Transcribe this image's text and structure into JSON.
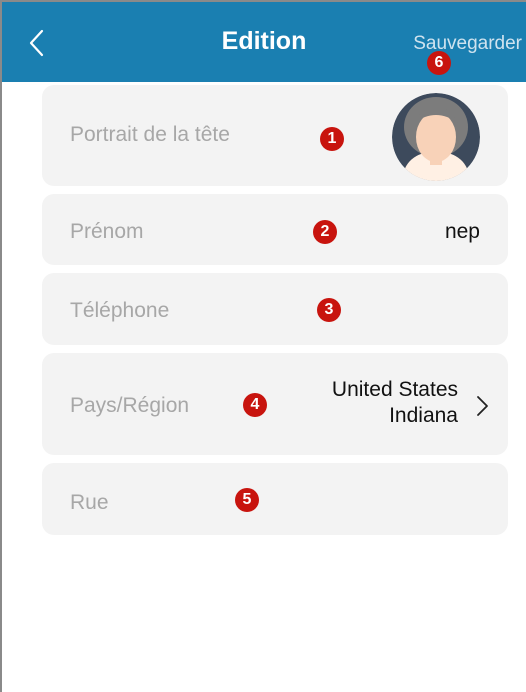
{
  "header": {
    "title": "Edition",
    "save_label": "Sauvegarder",
    "background": "#1a7fb1",
    "back_icon": "chevron-left-icon"
  },
  "form": {
    "portrait": {
      "label": "Portrait de la tête",
      "badge": "1",
      "avatar_icon": "avatar-icon"
    },
    "first_name": {
      "label": "Prénom",
      "value": "nep",
      "badge": "2"
    },
    "phone": {
      "label": "Téléphone",
      "value": "",
      "badge": "3"
    },
    "region": {
      "label": "Pays/Région",
      "value_line1": "United States",
      "value_line2": "Indiana",
      "badge": "4",
      "icon": "chevron-right-icon"
    },
    "street": {
      "label": "Rue",
      "value": "",
      "badge": "5"
    }
  },
  "save_badge": "6",
  "colors": {
    "badge": "#c8140e",
    "card": "#f3f3f3",
    "label": "#a7a7a7"
  }
}
